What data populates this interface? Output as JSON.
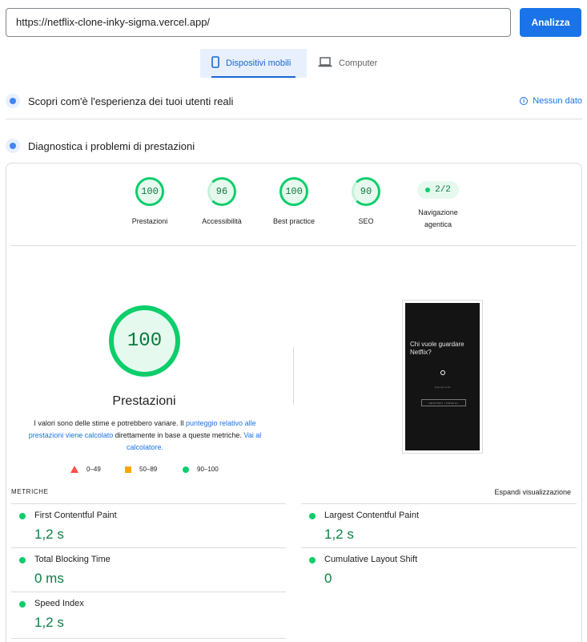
{
  "search": {
    "url": "https://netflix-clone-inky-sigma.vercel.app/",
    "analyze_label": "Analizza"
  },
  "tabs": [
    {
      "label": "Dispositivi mobili",
      "icon": "smartphone-icon",
      "active": true
    },
    {
      "label": "Computer",
      "icon": "laptop-icon",
      "active": false
    }
  ],
  "field_data": {
    "title": "Scopri com'è l'esperienza dei tuoi utenti reali",
    "status": "Nessun dato"
  },
  "lab": {
    "title": "Diagnostica i problemi di prestazioni"
  },
  "categories": [
    {
      "score": "100",
      "label": "Prestazioni"
    },
    {
      "score": "96",
      "label": "Accessibilità"
    },
    {
      "score": "100",
      "label": "Best practice"
    },
    {
      "score": "90",
      "label": "SEO"
    },
    {
      "score": "2/2",
      "label": "Navigazione agentica"
    }
  ],
  "performance": {
    "score": "100",
    "title": "Prestazioni",
    "desc_1": "I valori sono delle stime e potrebbero variare. Il ",
    "desc_link_1": "punteggio relativo alle prestazioni viene calcolato",
    "desc_2": " direttamente in base a queste metriche. ",
    "desc_link_2": "Vai al calcolatore.",
    "legend": {
      "fail": "0–49",
      "average": "50–89",
      "pass": "90–100"
    }
  },
  "screenshot": {
    "heading": "Chi vuole guardare Netflix?",
    "add_profile": "Aggiungi profilo",
    "manage": "GESTISCI I PROFILI"
  },
  "metrics": {
    "heading": "METRICHE",
    "expand": "Espandi visualizzazione",
    "items": [
      {
        "name": "First Contentful Paint",
        "value": "1,2 s"
      },
      {
        "name": "Largest Contentful Paint",
        "value": "1,2 s"
      },
      {
        "name": "Total Blocking Time",
        "value": "0 ms"
      },
      {
        "name": "Cumulative Layout Shift",
        "value": "0"
      },
      {
        "name": "Speed Index",
        "value": "1,2 s"
      }
    ]
  },
  "colors": {
    "accent": "#1a73e8",
    "pass": "#0cce6b",
    "pass_text": "#0b8043",
    "average": "#ffa400",
    "fail": "#ff4e42"
  }
}
